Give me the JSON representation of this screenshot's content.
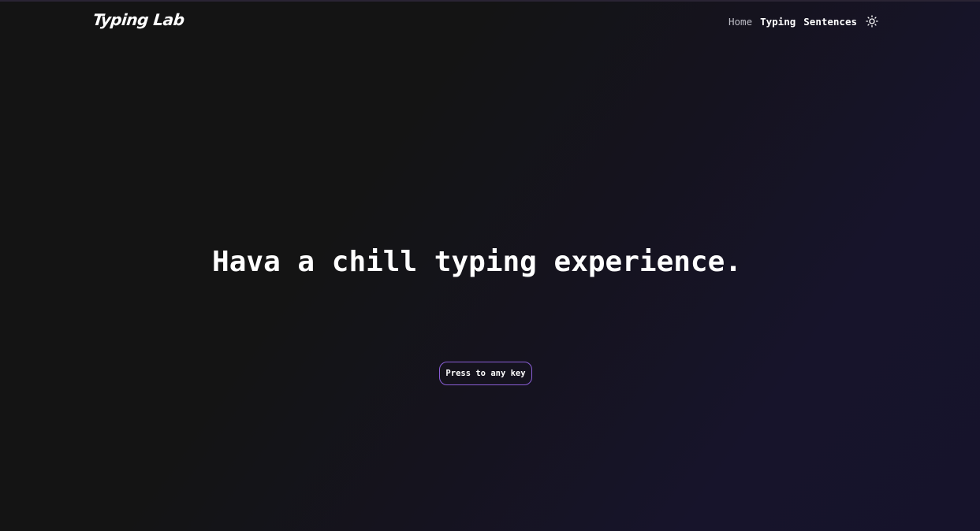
{
  "brand": {
    "logo_text": "Typing Lab"
  },
  "nav": {
    "items": [
      {
        "label": "Home"
      },
      {
        "label": "Typing"
      },
      {
        "label": "Sentences"
      }
    ],
    "theme_toggle_icon": "sun-icon"
  },
  "hero": {
    "title": "Hava a chill typing experience.",
    "button_label": "Press to any key"
  },
  "colors": {
    "background": "#141414",
    "gradient_accent": "#17142b",
    "button_border": "#8a5ed6",
    "text": "#ffffff",
    "muted_text": "#bdbdc6"
  }
}
